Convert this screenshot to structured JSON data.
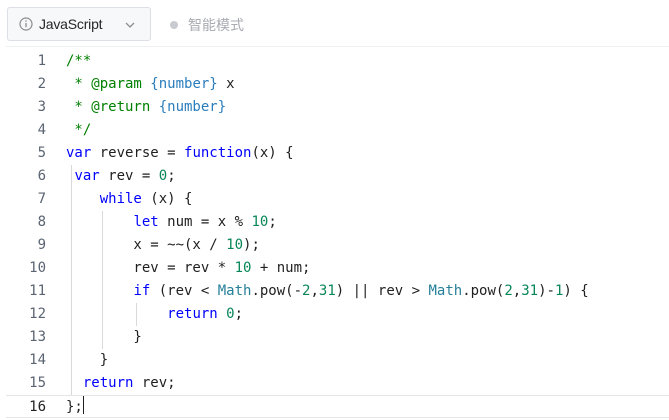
{
  "toolbar": {
    "language_label": "JavaScript",
    "mode_label": "智能模式"
  },
  "editor": {
    "lines": [
      {
        "n": "1",
        "tokens": [
          {
            "t": "/**",
            "c": "comment"
          }
        ]
      },
      {
        "n": "2",
        "tokens": [
          {
            "t": " * @param ",
            "c": "comment"
          },
          {
            "t": "{number}",
            "c": "type"
          },
          {
            "t": " x",
            "c": "plain"
          }
        ]
      },
      {
        "n": "3",
        "tokens": [
          {
            "t": " * @return ",
            "c": "comment"
          },
          {
            "t": "{number}",
            "c": "type"
          }
        ]
      },
      {
        "n": "4",
        "tokens": [
          {
            "t": " */",
            "c": "comment"
          }
        ]
      },
      {
        "n": "5",
        "tokens": [
          {
            "t": "var",
            "c": "keyword"
          },
          {
            "t": " reverse = ",
            "c": "plain"
          },
          {
            "t": "function",
            "c": "keyword"
          },
          {
            "t": "(x) {",
            "c": "plain"
          }
        ]
      },
      {
        "n": "6",
        "tokens": [
          {
            "t": " ",
            "c": "plain"
          },
          {
            "t": "var",
            "c": "keyword"
          },
          {
            "t": " rev = ",
            "c": "plain"
          },
          {
            "t": "0",
            "c": "number"
          },
          {
            "t": ";",
            "c": "plain"
          }
        ]
      },
      {
        "n": "7",
        "tokens": [
          {
            "t": "    ",
            "c": "plain"
          },
          {
            "t": "while",
            "c": "keyword"
          },
          {
            "t": " (x) {",
            "c": "plain"
          }
        ]
      },
      {
        "n": "8",
        "tokens": [
          {
            "t": "        ",
            "c": "plain"
          },
          {
            "t": "let",
            "c": "keyword"
          },
          {
            "t": " num = x % ",
            "c": "plain"
          },
          {
            "t": "10",
            "c": "number"
          },
          {
            "t": ";",
            "c": "plain"
          }
        ]
      },
      {
        "n": "9",
        "tokens": [
          {
            "t": "        x = ~~(x / ",
            "c": "plain"
          },
          {
            "t": "10",
            "c": "number"
          },
          {
            "t": ");",
            "c": "plain"
          }
        ]
      },
      {
        "n": "10",
        "tokens": [
          {
            "t": "        rev = rev * ",
            "c": "plain"
          },
          {
            "t": "10",
            "c": "number"
          },
          {
            "t": " + num;",
            "c": "plain"
          }
        ]
      },
      {
        "n": "11",
        "tokens": [
          {
            "t": "        ",
            "c": "plain"
          },
          {
            "t": "if",
            "c": "keyword"
          },
          {
            "t": " (rev < ",
            "c": "plain"
          },
          {
            "t": "Math",
            "c": "builtin"
          },
          {
            "t": ".pow(-",
            "c": "plain"
          },
          {
            "t": "2",
            "c": "number"
          },
          {
            "t": ",",
            "c": "plain"
          },
          {
            "t": "31",
            "c": "number"
          },
          {
            "t": ") || rev > ",
            "c": "plain"
          },
          {
            "t": "Math",
            "c": "builtin"
          },
          {
            "t": ".pow(",
            "c": "plain"
          },
          {
            "t": "2",
            "c": "number"
          },
          {
            "t": ",",
            "c": "plain"
          },
          {
            "t": "31",
            "c": "number"
          },
          {
            "t": ")-",
            "c": "plain"
          },
          {
            "t": "1",
            "c": "number"
          },
          {
            "t": ") {",
            "c": "plain"
          }
        ]
      },
      {
        "n": "12",
        "tokens": [
          {
            "t": "            ",
            "c": "plain"
          },
          {
            "t": "return",
            "c": "keyword"
          },
          {
            "t": " ",
            "c": "plain"
          },
          {
            "t": "0",
            "c": "number"
          },
          {
            "t": ";",
            "c": "plain"
          }
        ]
      },
      {
        "n": "13",
        "tokens": [
          {
            "t": "        }",
            "c": "plain"
          }
        ]
      },
      {
        "n": "14",
        "tokens": [
          {
            "t": "    }",
            "c": "plain"
          }
        ]
      },
      {
        "n": "15",
        "tokens": [
          {
            "t": "  ",
            "c": "plain"
          },
          {
            "t": "return",
            "c": "keyword"
          },
          {
            "t": " rev;",
            "c": "plain"
          }
        ]
      },
      {
        "n": "16",
        "tokens": [
          {
            "t": "};",
            "c": "plain"
          }
        ]
      }
    ],
    "active_line": 16
  },
  "colors": {
    "comment": "#008000",
    "keyword": "#0000ff",
    "number": "#098658",
    "type": "#2a7dbd",
    "builtin": "#267f99"
  }
}
